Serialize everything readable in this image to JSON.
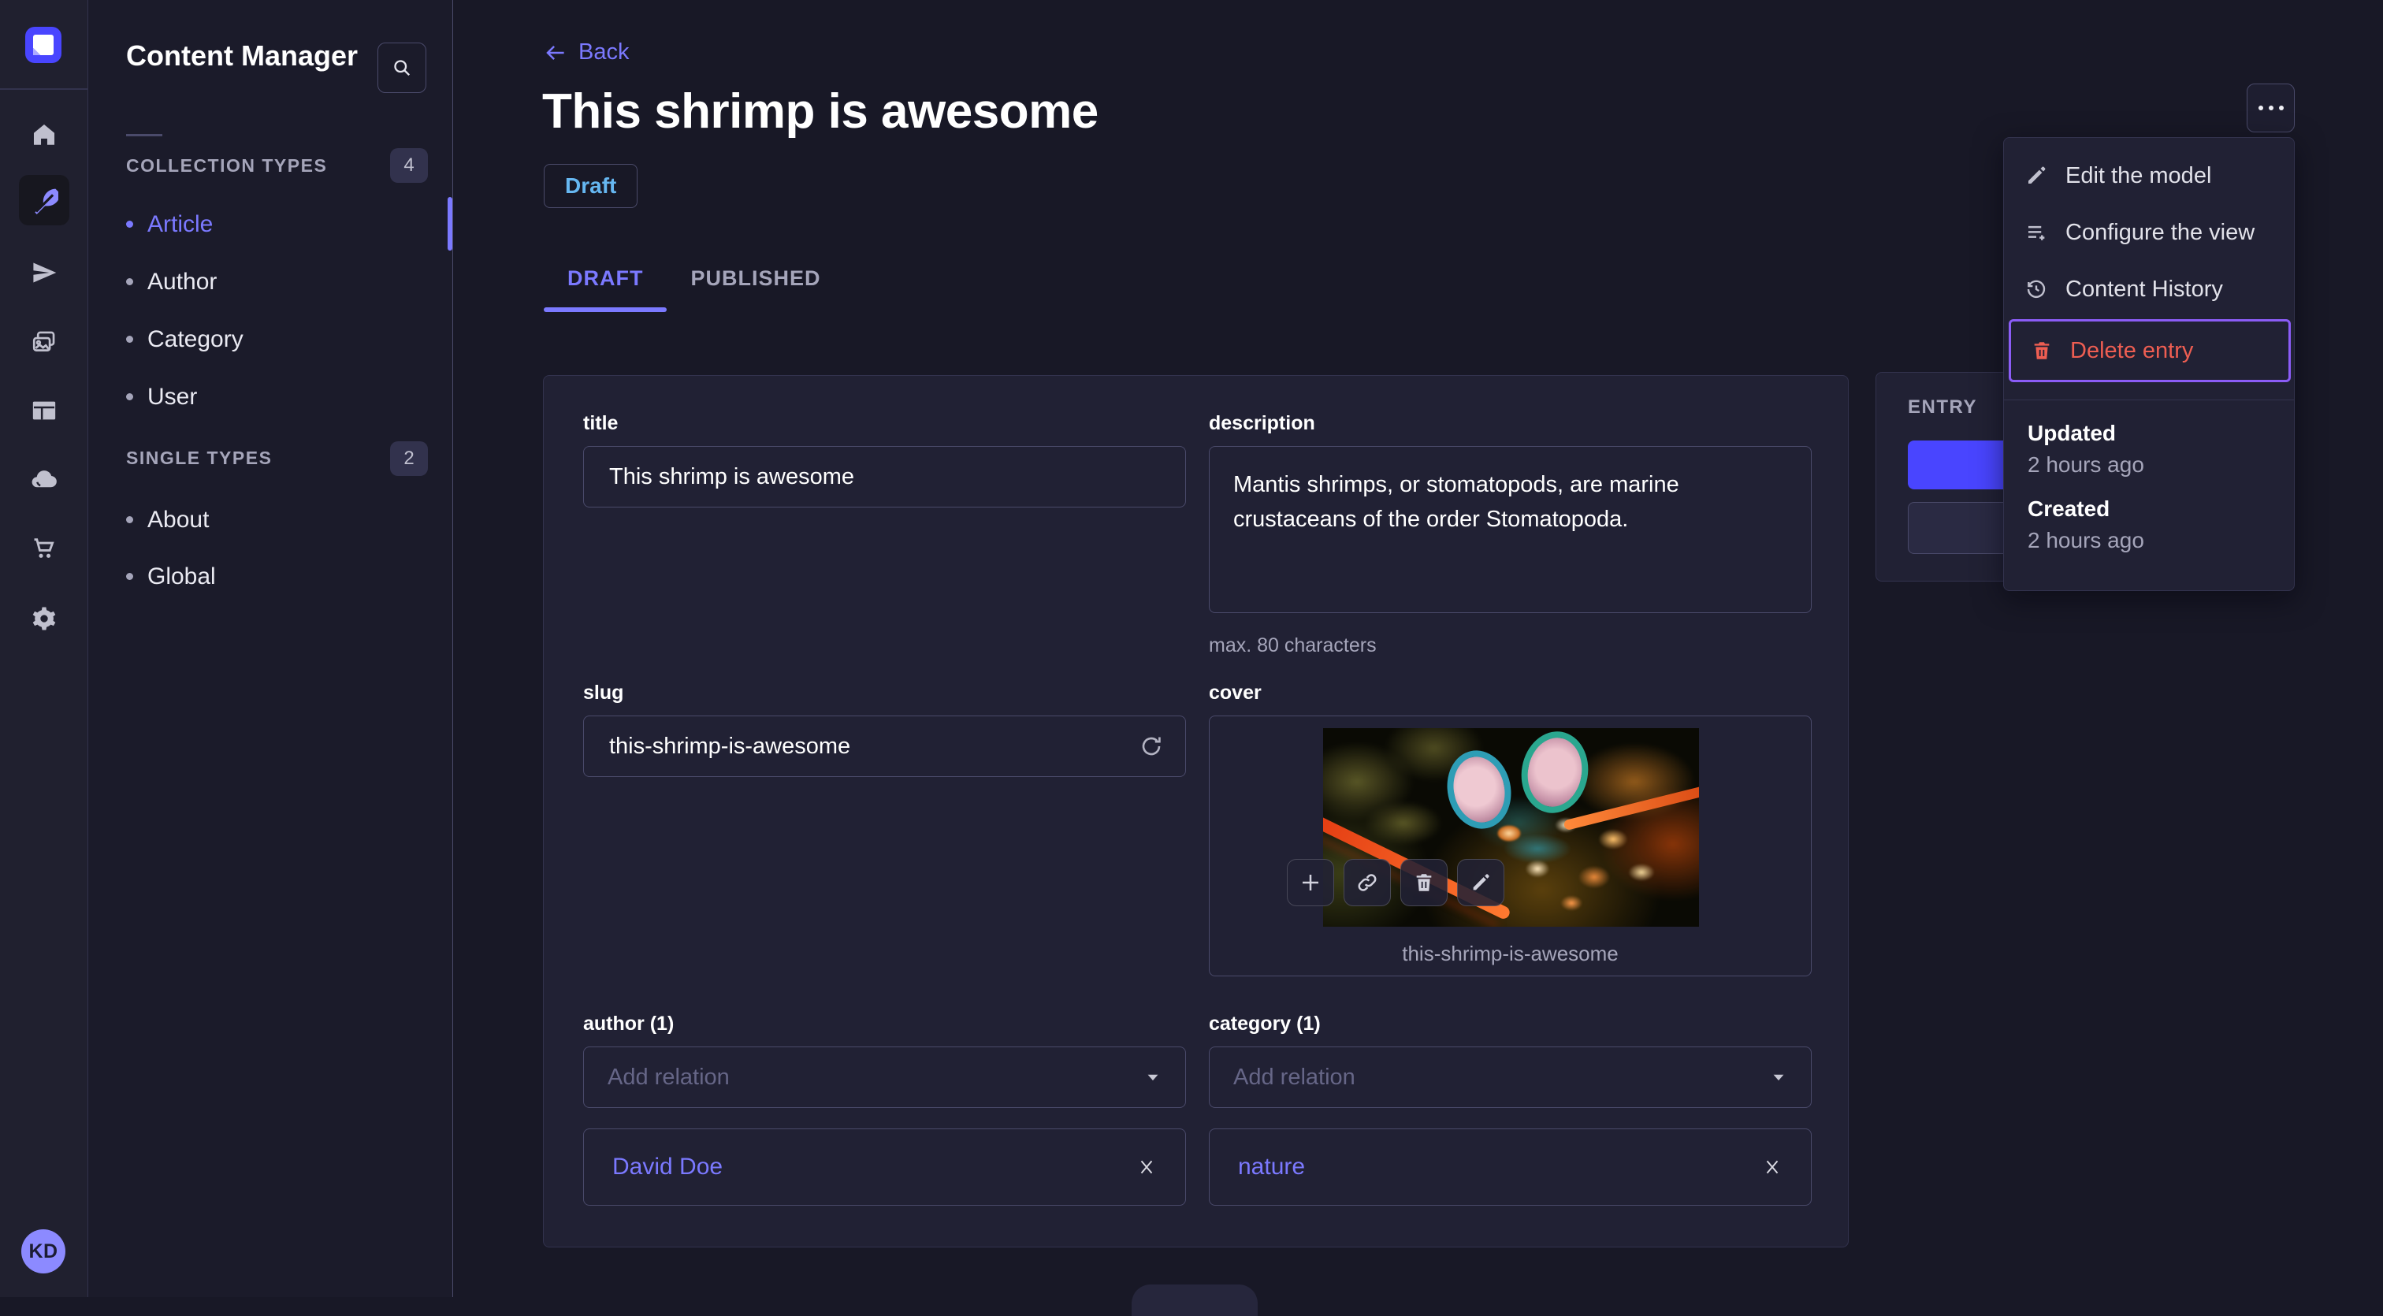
{
  "colors": {
    "accent": "#4945ff",
    "link": "#7b79ff",
    "draft_badge_text": "#66b7f1",
    "danger": "#ee5e52",
    "focus_ring": "#8b5cf6",
    "page_background": "#181826",
    "card_background": "#212134"
  },
  "nav_rail": {
    "avatar_initials": "KD",
    "icons": [
      "strapi-logo",
      "home",
      "content",
      "releases",
      "media-library",
      "content-type-builder",
      "cloud",
      "marketplace",
      "settings"
    ]
  },
  "subnav": {
    "title": "Content Manager",
    "sections": [
      {
        "label": "COLLECTION TYPES",
        "count": "4",
        "items": [
          {
            "label": "Article",
            "active": true
          },
          {
            "label": "Author",
            "active": false
          },
          {
            "label": "Category",
            "active": false
          },
          {
            "label": "User",
            "active": false
          }
        ]
      },
      {
        "label": "SINGLE TYPES",
        "count": "2",
        "items": [
          {
            "label": "About",
            "active": false
          },
          {
            "label": "Global",
            "active": false
          }
        ]
      }
    ]
  },
  "header": {
    "back_label": "Back",
    "title": "This shrimp is awesome",
    "status": "Draft",
    "tabs": [
      {
        "label": "DRAFT",
        "active": true
      },
      {
        "label": "PUBLISHED",
        "active": false
      }
    ]
  },
  "form": {
    "title": {
      "label": "title",
      "value": "This shrimp is awesome"
    },
    "description": {
      "label": "description",
      "value": "Mantis shrimps, or stomatopods, are marine crustaceans of the order Stomatopoda.",
      "hint": "max. 80 characters"
    },
    "slug": {
      "label": "slug",
      "value": "this-shrimp-is-awesome"
    },
    "cover": {
      "label": "cover",
      "caption": "this-shrimp-is-awesome"
    },
    "author": {
      "label": "author (1)",
      "placeholder": "Add relation",
      "relation": "David Doe"
    },
    "category": {
      "label": "category (1)",
      "placeholder": "Add relation",
      "relation": "nature"
    }
  },
  "entry_panel": {
    "title": "ENTRY"
  },
  "context_menu": {
    "items": [
      {
        "label": "Edit the model"
      },
      {
        "label": "Configure the view"
      },
      {
        "label": "Content History"
      },
      {
        "label": "Delete entry"
      }
    ],
    "meta": [
      {
        "label": "Updated",
        "value": "2 hours ago"
      },
      {
        "label": "Created",
        "value": "2 hours ago"
      }
    ]
  }
}
